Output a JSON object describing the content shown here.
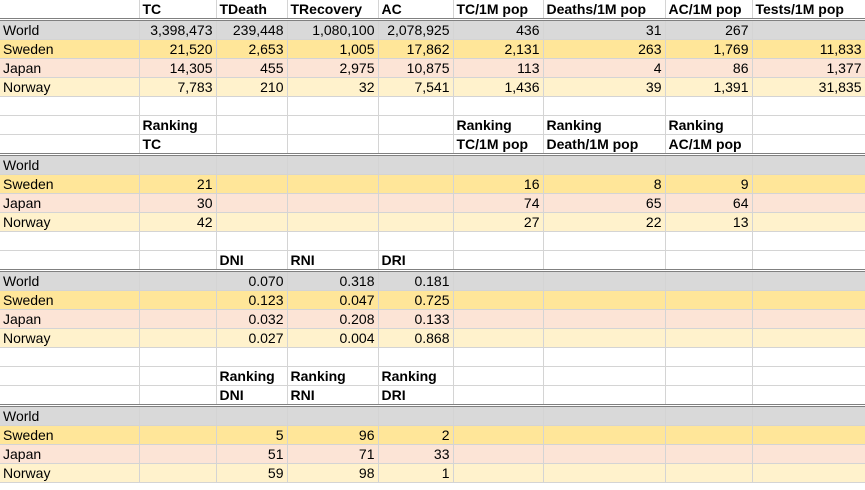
{
  "section1": {
    "headers": [
      "",
      "TC",
      "TDeath",
      "TRecovery",
      "AC",
      "TC/1M pop",
      "Deaths/1M pop",
      "AC/1M pop",
      "Tests/1M pop"
    ],
    "rows": [
      [
        "World",
        "3,398,473",
        "239,448",
        "1,080,100",
        "2,078,925",
        "436",
        "31",
        "267",
        ""
      ],
      [
        "Sweden",
        "21,520",
        "2,653",
        "1,005",
        "17,862",
        "2,131",
        "263",
        "1,769",
        "11,833"
      ],
      [
        "Japan",
        "14,305",
        "455",
        "2,975",
        "10,875",
        "113",
        "4",
        "86",
        "1,377"
      ],
      [
        "Norway",
        "7,783",
        "210",
        "32",
        "7,541",
        "1,436",
        "39",
        "1,391",
        "31,835"
      ]
    ]
  },
  "section2": {
    "header1": [
      "",
      "Ranking",
      "",
      "",
      "",
      "Ranking",
      "Ranking",
      "Ranking",
      ""
    ],
    "header2": [
      "",
      "TC",
      "",
      "",
      "",
      "TC/1M pop",
      "Death/1M pop",
      "AC/1M pop",
      ""
    ],
    "rows": [
      [
        "World",
        "",
        "",
        "",
        "",
        "",
        "",
        "",
        ""
      ],
      [
        "Sweden",
        "21",
        "",
        "",
        "",
        "16",
        "8",
        "9",
        ""
      ],
      [
        "Japan",
        "30",
        "",
        "",
        "",
        "74",
        "65",
        "64",
        ""
      ],
      [
        "Norway",
        "42",
        "",
        "",
        "",
        "27",
        "22",
        "13",
        ""
      ]
    ]
  },
  "section3": {
    "headers": [
      "",
      "",
      "DNI",
      "RNI",
      "DRI",
      "",
      "",
      "",
      ""
    ],
    "rows": [
      [
        "World",
        "",
        "0.070",
        "0.318",
        "0.181",
        "",
        "",
        "",
        ""
      ],
      [
        "Sweden",
        "",
        "0.123",
        "0.047",
        "0.725",
        "",
        "",
        "",
        ""
      ],
      [
        "Japan",
        "",
        "0.032",
        "0.208",
        "0.133",
        "",
        "",
        "",
        ""
      ],
      [
        "Norway",
        "",
        "0.027",
        "0.004",
        "0.868",
        "",
        "",
        "",
        ""
      ]
    ]
  },
  "section4": {
    "header1": [
      "",
      "",
      "Ranking",
      "Ranking",
      "Ranking",
      "",
      "",
      "",
      ""
    ],
    "header2": [
      "",
      "",
      "DNI",
      "RNI",
      "DRI",
      "",
      "",
      "",
      ""
    ],
    "rows": [
      [
        "World",
        "",
        "",
        "",
        "",
        "",
        "",
        "",
        ""
      ],
      [
        "Sweden",
        "",
        "5",
        "96",
        "2",
        "",
        "",
        "",
        ""
      ],
      [
        "Japan",
        "",
        "51",
        "71",
        "33",
        "",
        "",
        "",
        ""
      ],
      [
        "Norway",
        "",
        "59",
        "98",
        "1",
        "",
        "",
        "",
        ""
      ]
    ]
  },
  "colors": {
    "world": "#d9d9d9",
    "sweden": "#ffe699",
    "japan": "#fce4d6",
    "norway": "#fff2cc",
    "grid": "#d4d4d4"
  }
}
